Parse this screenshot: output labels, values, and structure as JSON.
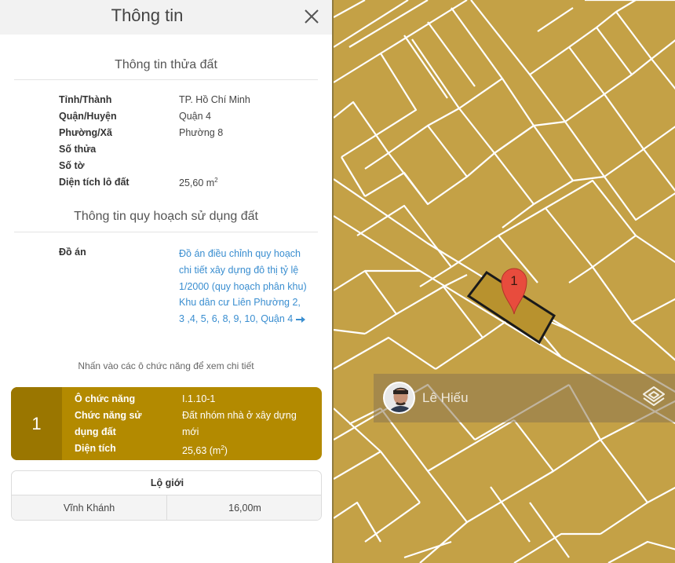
{
  "panel": {
    "title": "Thông tin",
    "land_section_title": "Thông tin thửa đất",
    "land_info": [
      {
        "label": "Tỉnh/Thành",
        "value": "TP. Hồ Chí Minh"
      },
      {
        "label": "Quận/Huyện",
        "value": "Quận 4"
      },
      {
        "label": "Phường/Xã",
        "value": "Phường 8"
      },
      {
        "label": "Số thửa",
        "value": ""
      },
      {
        "label": "Số tờ",
        "value": ""
      },
      {
        "label": "Diện tích lô đất",
        "value": "25,60 m",
        "unit_sup": "2"
      }
    ],
    "planning_section_title": "Thông tin quy hoạch sử dụng đất",
    "plan_label": "Đồ án",
    "plan_link": "Đồ án điều chỉnh quy hoạch chi tiết xây dựng đô thị tỷ lệ 1/2000 (quy hoạch phân khu) Khu dân cư Liên Phường 2, 3 ,4, 5, 6, 8, 9, 10, Quận 4",
    "hint": "Nhấn vào các ô chức năng để xem chi tiết",
    "zone": {
      "number": "1",
      "color": "#b38a00",
      "rows": [
        {
          "label": "Ô chức năng",
          "value": "I.1.10-1"
        },
        {
          "label": "Chức năng sử dụng đất",
          "value": "Đất nhóm nhà ở xây dựng mới"
        },
        {
          "label": "Diện tích",
          "value": "25,63 (m",
          "unit_sup": "2",
          "value_suffix": ")"
        }
      ]
    },
    "road": {
      "header": "Lộ giới",
      "name": "Vĩnh Khánh",
      "width": "16,00m"
    }
  },
  "map": {
    "fill_color": "#c4a146",
    "line_color": "#ffffff",
    "marker_label": "1",
    "marker_color": "#e84c3d",
    "user_name": "Lê Hiếu"
  }
}
